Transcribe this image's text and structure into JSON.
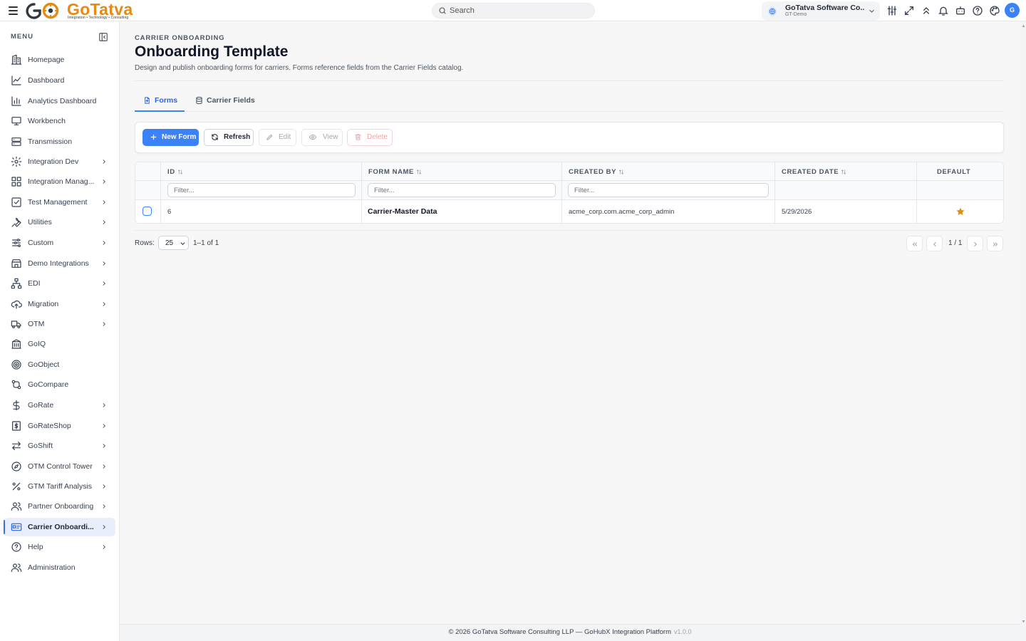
{
  "header": {
    "logo_text": "GoTatva",
    "logo_tagline": "Integration • Technology • Consulting",
    "search_placeholder": "Search",
    "tenant_name": "GoTatva Software Co...",
    "tenant_sub": "GT-Demo",
    "avatar_initial": "G"
  },
  "sidebar": {
    "menu_label": "MENU",
    "items": [
      {
        "label": "Homepage",
        "icon": "building-icon",
        "chevron": false
      },
      {
        "label": "Dashboard",
        "icon": "line-chart-icon",
        "chevron": false
      },
      {
        "label": "Analytics Dashboard",
        "icon": "bar-chart-icon",
        "chevron": false
      },
      {
        "label": "Workbench",
        "icon": "monitor-icon",
        "chevron": false
      },
      {
        "label": "Transmission",
        "icon": "server-icon",
        "chevron": false
      },
      {
        "label": "Integration Dev",
        "icon": "gear-icon",
        "chevron": true
      },
      {
        "label": "Integration Manag...",
        "icon": "grid-icon",
        "chevron": true
      },
      {
        "label": "Test Management",
        "icon": "checkbox-icon",
        "chevron": true
      },
      {
        "label": "Utilities",
        "icon": "wrench-icon",
        "chevron": true
      },
      {
        "label": "Custom",
        "icon": "sliders-icon",
        "chevron": true
      },
      {
        "label": "Demo Integrations",
        "icon": "store-icon",
        "chevron": true
      },
      {
        "label": "EDI",
        "icon": "network-icon",
        "chevron": true
      },
      {
        "label": "Migration",
        "icon": "cloud-upload-icon",
        "chevron": true
      },
      {
        "label": "OTM",
        "icon": "truck-icon",
        "chevron": true
      },
      {
        "label": "GoIQ",
        "icon": "library-icon",
        "chevron": false
      },
      {
        "label": "GoObject",
        "icon": "target-icon",
        "chevron": false
      },
      {
        "label": "GoCompare",
        "icon": "git-compare-icon",
        "chevron": false
      },
      {
        "label": "GoRate",
        "icon": "dollar-icon",
        "chevron": true
      },
      {
        "label": "GoRateShop",
        "icon": "receipt-dollar-icon",
        "chevron": true
      },
      {
        "label": "GoShift",
        "icon": "arrows-swap-icon",
        "chevron": true
      },
      {
        "label": "OTM Control Tower",
        "icon": "compass-icon",
        "chevron": true
      },
      {
        "label": "GTM Tariff Analysis",
        "icon": "percent-icon",
        "chevron": true
      },
      {
        "label": "Partner Onboarding",
        "icon": "users-icon",
        "chevron": true
      },
      {
        "label": "Carrier Onboardi...",
        "icon": "id-card-icon",
        "chevron": true,
        "active": true
      },
      {
        "label": "Help",
        "icon": "help-circle-icon",
        "chevron": true
      },
      {
        "label": "Administration",
        "icon": "admin-users-icon",
        "chevron": false
      }
    ]
  },
  "page": {
    "breadcrumb": "CARRIER ONBOARDING",
    "title": "Onboarding Template",
    "description": "Design and publish onboarding forms for carriers. Forms reference fields from the Carrier Fields catalog.",
    "tabs": [
      {
        "label": "Forms",
        "active": true
      },
      {
        "label": "Carrier Fields",
        "active": false
      }
    ]
  },
  "toolbar": {
    "new_label": "New Form",
    "refresh_label": "Refresh",
    "edit_label": "Edit",
    "view_label": "View",
    "delete_label": "Delete"
  },
  "table": {
    "columns": [
      "ID",
      "FORM NAME",
      "CREATED BY",
      "CREATED DATE",
      "DEFAULT"
    ],
    "filter_placeholder": "Filter...",
    "rows": [
      {
        "id": "6",
        "form_name": "Carrier-Master Data",
        "created_by": "acme_corp.com.acme_corp_admin",
        "created_date": "5/29/2026",
        "default": true
      }
    ]
  },
  "pagination": {
    "rows_label": "Rows:",
    "rows_per_page": "25",
    "range": "1–1 of 1",
    "page_indicator": "1 / 1"
  },
  "footer": {
    "text": "© 2026 GoTatva Software Consulting LLP — GoHubX Integration Platform",
    "version": "v1.0.0"
  },
  "colors": {
    "accent": "#3b82f6",
    "brand_orange": "#e58b12",
    "star": "#e58b12"
  }
}
